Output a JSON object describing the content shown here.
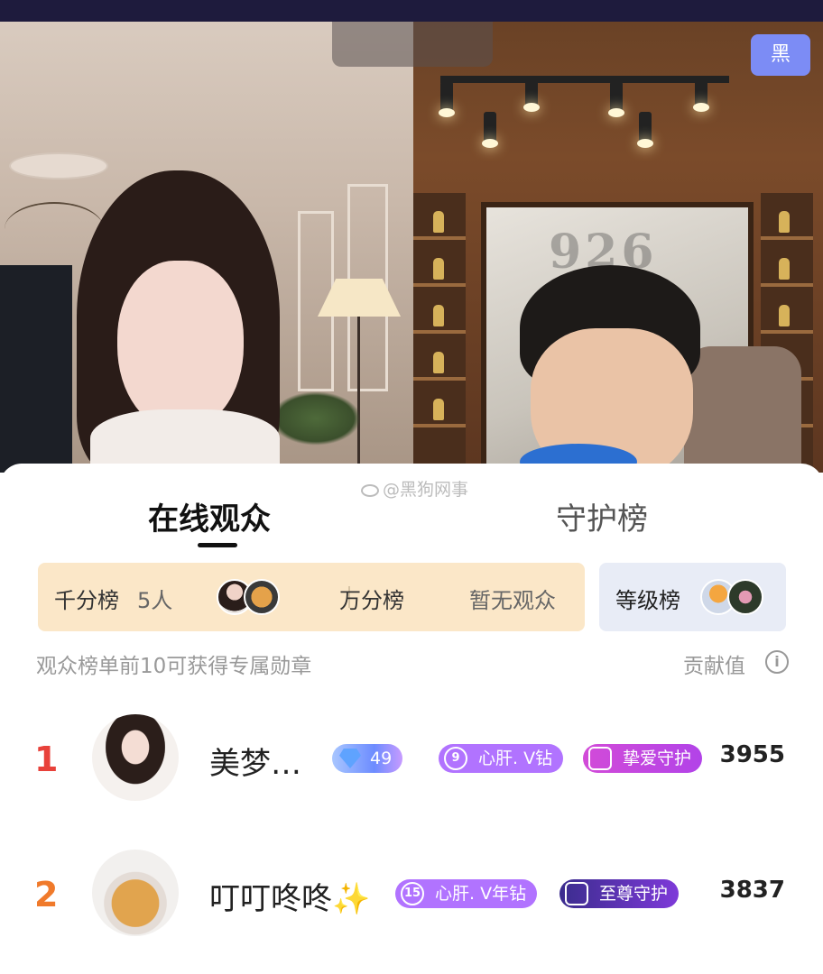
{
  "video": {
    "art_text": "926",
    "black_button": "黑"
  },
  "watermark": "@黑狗网事",
  "tabs": {
    "online": "在线观众",
    "guard": "守护榜"
  },
  "rank_bar": {
    "qianfen_label": "千分榜",
    "qianfen_count": "5人",
    "wanfen_label": "万分榜",
    "wanfen_status": "暂无观众"
  },
  "level_button": "等级榜",
  "hint": "观众榜单前10可获得专属勋章",
  "contribution_label": "贡献值",
  "info_icon": "i",
  "viewers": [
    {
      "rank": "1",
      "name": "美梦…",
      "level": "49",
      "fan_badge_level": "9",
      "fan_badge_text": "心肝. V钻",
      "guard_badge": "挚爱守护",
      "score": "3955"
    },
    {
      "rank": "2",
      "name": "叮叮咚咚✨",
      "fan_badge_level": "15",
      "fan_badge_text": "心肝. V年钻",
      "guard_badge": "至尊守护",
      "score": "3837"
    }
  ],
  "colors": {
    "rank1": "#e8413a",
    "rank2": "#f07a2b",
    "rank_bar_bg": "#fbe7c8",
    "level_bg": "#e8ecf6"
  }
}
